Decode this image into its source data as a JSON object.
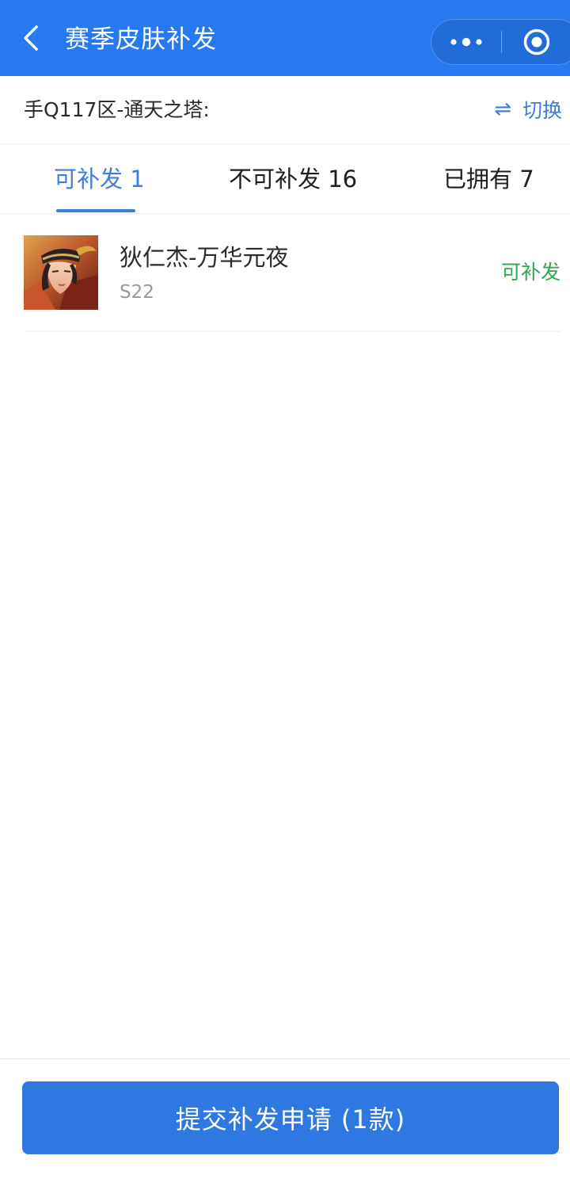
{
  "header": {
    "title": "赛季皮肤补发",
    "back_icon": "chevron-left-icon",
    "more_icon": "more-dots-icon",
    "close_icon": "target-circle-icon",
    "background_color": "#2679f0"
  },
  "server": {
    "label": "手Q117区-通天之塔:",
    "switch_label": "切换",
    "switch_icon_glyph": "⇌"
  },
  "tabs": [
    {
      "label": "可补发 1",
      "active": true
    },
    {
      "label": "不可补发 16",
      "active": false
    },
    {
      "label": "已拥有 7",
      "active": false
    }
  ],
  "items": [
    {
      "name": "狄仁杰-万华元夜",
      "season": "S22",
      "status": "可补发",
      "status_color": "#2ea84a"
    }
  ],
  "footer": {
    "submit_label": "提交补发申请 (1款)",
    "button_color": "#2f78e2"
  },
  "accent_color": "#3c80d8"
}
